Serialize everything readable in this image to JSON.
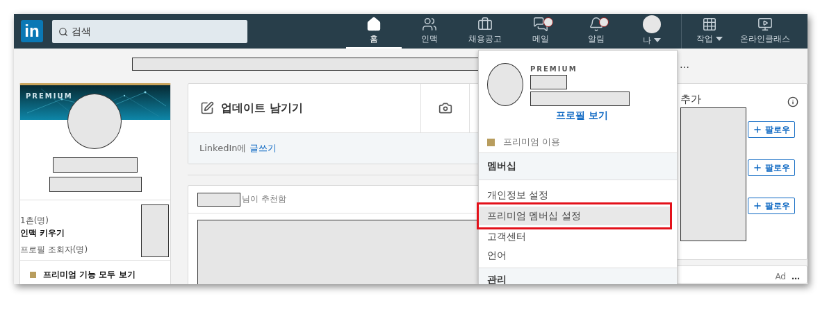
{
  "nav": {
    "logo": "in",
    "search": {
      "placeholder": "검색"
    },
    "items": [
      {
        "label": "홈",
        "kind": "home",
        "selected": true,
        "badge": false,
        "dropdown": false
      },
      {
        "label": "인맥",
        "kind": "people",
        "selected": false,
        "badge": false,
        "dropdown": false
      },
      {
        "label": "채용공고",
        "kind": "briefcase",
        "selected": false,
        "badge": false,
        "dropdown": false
      },
      {
        "label": "메일",
        "kind": "messages",
        "selected": false,
        "badge": true,
        "dropdown": false
      },
      {
        "label": "알림",
        "kind": "bell",
        "selected": false,
        "badge": true,
        "dropdown": false
      },
      {
        "label": "나",
        "kind": "avatar",
        "selected": false,
        "badge": false,
        "dropdown": true
      }
    ],
    "extra_items": [
      {
        "label": "작업",
        "kind": "grid",
        "dropdown": true
      },
      {
        "label": "온라인클래스",
        "kind": "video",
        "dropdown": false
      }
    ]
  },
  "top_more": "…",
  "profile_card": {
    "banner_label": "PREMIUM",
    "connections": "1촌(명)",
    "grow_link": "인맥 키우기",
    "viewers": "프로필 조회자(명)",
    "premium_link": "프리미엄 기능 모두 보기"
  },
  "share_box": {
    "title": "업데이트 남기기",
    "prompt": "LinkedIn에",
    "prompt_link": "글쓰기"
  },
  "feed_card": {
    "recommended_suffix": "님이 추천함"
  },
  "account_menu": {
    "premium_label": "PREMIUM",
    "view_profile": "프로필 보기",
    "premium_item": "프리미엄 이용",
    "sections": [
      {
        "header": "멤버십",
        "items": [
          {
            "label": "개인정보 설정",
            "highlighted": false
          },
          {
            "label": "프리미엄 멤버십 설정",
            "highlighted": true
          },
          {
            "label": "고객센터",
            "highlighted": false
          },
          {
            "label": "언어",
            "highlighted": false
          }
        ]
      },
      {
        "header": "관리"
      }
    ]
  },
  "follow_card": {
    "title": "추가",
    "buttons": [
      {
        "label": "팔로우"
      },
      {
        "label": "팔로우"
      },
      {
        "label": "팔로우"
      }
    ]
  },
  "ad_card": {
    "label": "Ad",
    "more": "…"
  }
}
